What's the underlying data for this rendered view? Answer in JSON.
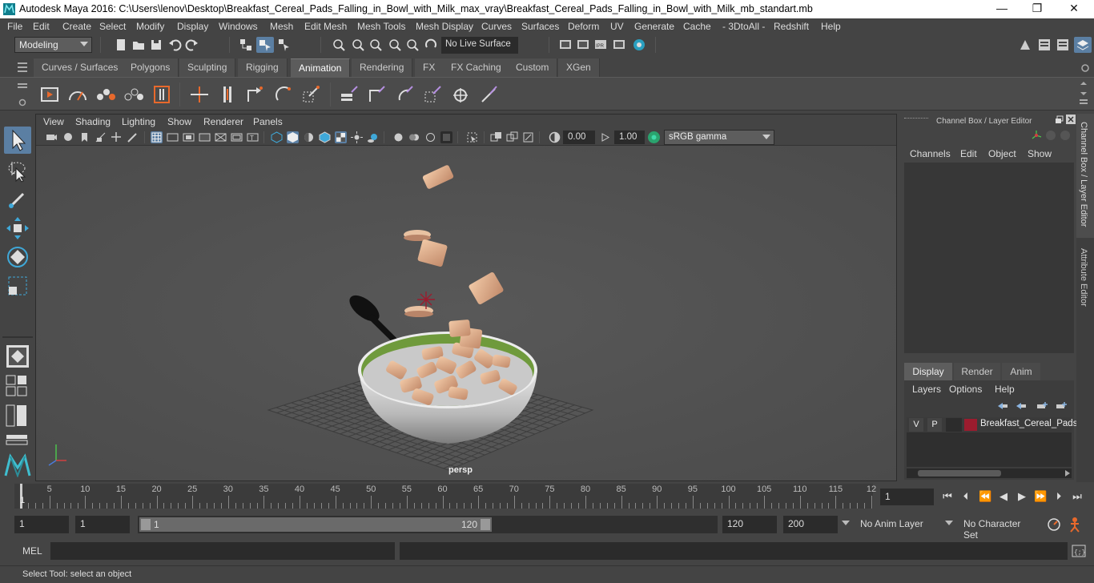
{
  "window": {
    "title": "Autodesk Maya 2016: C:\\Users\\lenov\\Desktop\\Breakfast_Cereal_Pads_Falling_in_Bowl_with_Milk_max_vray\\Breakfast_Cereal_Pads_Falling_in_Bowl_with_Milk_mb_standart.mb",
    "minimize": "—",
    "restore": "❐",
    "close": "✕"
  },
  "menu": [
    "File",
    "Edit",
    "Create",
    "Select",
    "Modify",
    "Display",
    "Windows",
    "Mesh",
    "Edit Mesh",
    "Mesh Tools",
    "Mesh Display",
    "Curves",
    "Surfaces",
    "Deform",
    "UV",
    "Generate",
    "Cache",
    "- 3DtoAll -",
    "Redshift",
    "Help"
  ],
  "status": {
    "mode": "Modeling",
    "live_surface": "No Live Surface"
  },
  "shelf_tabs": [
    "Curves / Surfaces",
    "Polygons",
    "Sculpting",
    "Rigging",
    "Animation",
    "Rendering",
    "FX",
    "FX Caching",
    "Custom",
    "XGen"
  ],
  "active_shelf_tab": "Animation",
  "viewport": {
    "menus": [
      "View",
      "Shading",
      "Lighting",
      "Show",
      "Renderer",
      "Panels"
    ],
    "exposure": "0.00",
    "gamma": "1.00",
    "color_space": "sRGB gamma",
    "camera_label": "persp"
  },
  "right_panel": {
    "title": "Channel Box / Layer Editor",
    "channel_menus": [
      "Channels",
      "Edit",
      "Object",
      "Show"
    ],
    "layer_tabs": [
      "Display",
      "Render",
      "Anim"
    ],
    "active_layer_tab": "Display",
    "layer_menus": [
      "Layers",
      "Options",
      "Help"
    ],
    "layer": {
      "v": "V",
      "p": "P",
      "name": "Breakfast_Cereal_Pads_",
      "color": "#9b1c2e"
    },
    "side_tabs": [
      "Channel Box / Layer Editor",
      "Attribute Editor"
    ]
  },
  "timeline": {
    "labels": [
      "5",
      "10",
      "15",
      "20",
      "25",
      "30",
      "35",
      "40",
      "45",
      "50",
      "55",
      "60",
      "65",
      "70",
      "75",
      "80",
      "85",
      "90",
      "95",
      "100",
      "105",
      "110",
      "115",
      "12"
    ],
    "start_label": "1",
    "current_frame": "1"
  },
  "range": {
    "start": "1",
    "playback_start": "1",
    "slider_start": "1",
    "slider_end": "120",
    "end": "120",
    "anim_end": "200",
    "anim_layer": "No Anim Layer",
    "character_set": "No Character Set"
  },
  "command": {
    "label": "MEL"
  },
  "help_line": "Select Tool: select an object"
}
